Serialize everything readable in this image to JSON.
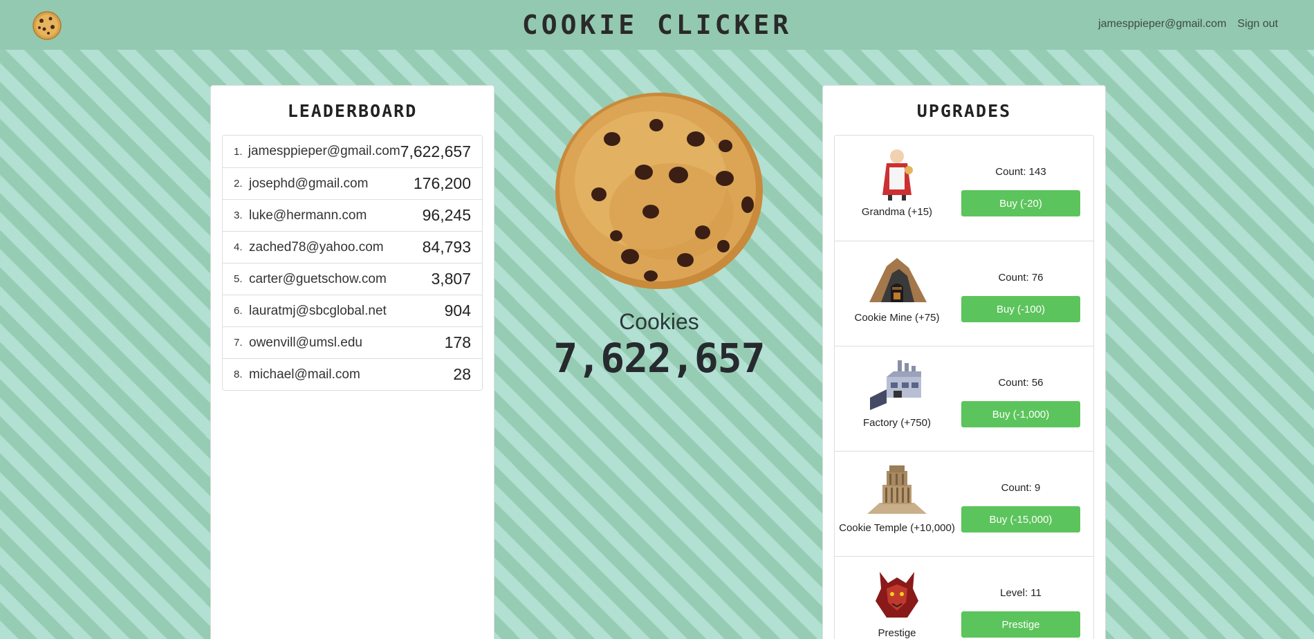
{
  "nav": {
    "title": "COOKIE CLICKER",
    "user_email": "jamesppieper@gmail.com",
    "sign_out": "Sign out",
    "logo_icon": "cookie-icon"
  },
  "leaderboard": {
    "title": "LEADERBOARD",
    "rows": [
      {
        "rank": "1.",
        "email": "jamesppieper@gmail.com",
        "score": "7,622,657"
      },
      {
        "rank": "2.",
        "email": "josephd@gmail.com",
        "score": "176,200"
      },
      {
        "rank": "3.",
        "email": "luke@hermann.com",
        "score": "96,245"
      },
      {
        "rank": "4.",
        "email": "zached78@yahoo.com",
        "score": "84,793"
      },
      {
        "rank": "5.",
        "email": "carter@guetschow.com",
        "score": "3,807"
      },
      {
        "rank": "6.",
        "email": "lauratmj@sbcglobal.net",
        "score": "904"
      },
      {
        "rank": "7.",
        "email": "owenvill@umsl.edu",
        "score": "178"
      },
      {
        "rank": "8.",
        "email": "michael@mail.com",
        "score": "28"
      }
    ]
  },
  "center": {
    "label": "Cookies",
    "count": "7,622,657",
    "cookie_icon": "big-cookie-icon"
  },
  "upgrades": {
    "title": "UPGRADES",
    "items": [
      {
        "name": "Grandma (+15)",
        "count": "Count: 143",
        "button": "Buy (-20)",
        "icon": "grandma-icon"
      },
      {
        "name": "Cookie Mine (+75)",
        "count": "Count: 76",
        "button": "Buy (-100)",
        "icon": "mine-icon"
      },
      {
        "name": "Factory (+750)",
        "count": "Count: 56",
        "button": "Buy (-1,000)",
        "icon": "factory-icon"
      },
      {
        "name": "Cookie Temple (+10,000)",
        "count": "Count: 9",
        "button": "Buy (-15,000)",
        "icon": "temple-icon"
      },
      {
        "name": "Prestige",
        "count": "Level: 11",
        "button": "Prestige",
        "icon": "dragon-icon"
      }
    ]
  },
  "colors": {
    "navbar": "#93c9b0",
    "stripe_light": "#b2e0d2",
    "stripe_dark": "#96ccb3",
    "buy_button": "#5cc45c"
  }
}
